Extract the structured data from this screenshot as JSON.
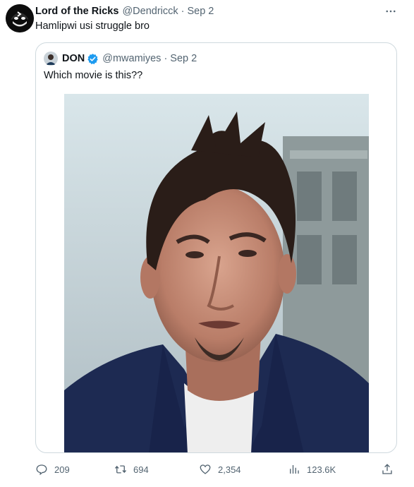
{
  "tweet": {
    "author_name": "Lord of the Ricks",
    "author_handle": "@Dendricck",
    "separator": "·",
    "time": "Sep 2",
    "text": "Hamlipwi usi struggle bro",
    "avatar_icon": "masked-face-avatar",
    "more_icon": "more-horizontal-icon"
  },
  "quote": {
    "author_name": "DON",
    "author_handle": "@mwamiyes",
    "separator": "·",
    "time": "Sep 2",
    "verified_icon": "verified-badge-icon",
    "text": "Which movie is this??",
    "media_description_icon": "photo-man-portrait"
  },
  "actions": {
    "replies": "209",
    "retweets": "694",
    "likes": "2,354",
    "views": "123.6K",
    "icons": [
      "reply-icon",
      "retweet-icon",
      "like-icon",
      "views-icon",
      "share-icon"
    ]
  },
  "colors": {
    "text_primary": "#0f1419",
    "text_secondary": "#536471",
    "border": "#cfd9de",
    "verified_blue": "#1d9bf0"
  }
}
